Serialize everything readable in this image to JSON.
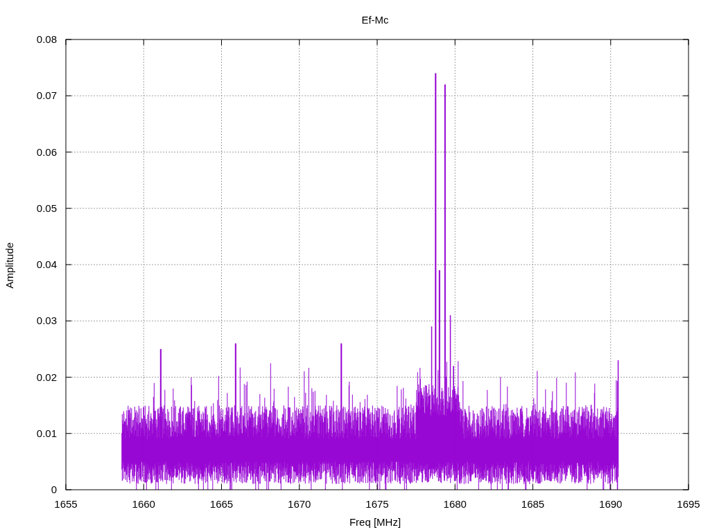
{
  "title": "Ef-Mc",
  "ylabel": "Amplitude",
  "xlabel": "Freq [MHz]",
  "yticks": [
    "0.08",
    "0.07",
    "0.06",
    "0.05",
    "0.04",
    "0.03",
    "0.02",
    "0.01",
    "0"
  ],
  "xticks": [
    "1655",
    "1660",
    "1665",
    "1670",
    "1675",
    "1680",
    "1685",
    "1690",
    "1695"
  ]
}
